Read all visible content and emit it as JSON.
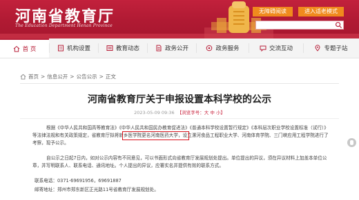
{
  "header": {
    "title": "河南省教育厅",
    "subtitle": "The Education Department Henan Province",
    "care_mode": "无障碍阅读",
    "elderly_mode": "进入适老模式",
    "search_placeholder": ""
  },
  "nav": {
    "items": [
      {
        "label": "首 页",
        "icon": "home-icon"
      },
      {
        "label": "机构设置",
        "icon": "building-icon"
      },
      {
        "label": "教育动态",
        "icon": "news-icon"
      },
      {
        "label": "政务公开",
        "icon": "document-icon"
      },
      {
        "label": "政务服务",
        "icon": "service-icon"
      },
      {
        "label": "交流互动",
        "icon": "chat-icon"
      },
      {
        "label": "专题子站",
        "icon": "pin-icon"
      }
    ],
    "active_index": 0
  },
  "breadcrumb": {
    "home": "首页",
    "info": "信息公开",
    "notice": "公告公示",
    "current": "正文"
  },
  "article": {
    "title": "河南省教育厅关于申报设置本科学校的公示",
    "date": "2023-05-09 09:36",
    "font_label": "【浏览字号：",
    "font_large": "大",
    "font_mid": "中",
    "font_small": "小",
    "font_end": "】",
    "p1": "根据《中华人民共和国高等教育法》《中华人民共和国民办教育促进法》《普通本科学校设置暂行规定》《本科层次职业学校设置标准（试行）》等法律法规和有关政策规定，省教育厅拟将新乡医学院更名河南医药大学，设立漯河食品工程职业大学、河南体育学院、三门峡应用工程学院进行了考察，现予公示。",
    "p2": "自公示之日起7日内，如对公示内容有不同意见，可以书面形式向省教育厅发展规划处提出。单位提出的异议，须在异议材料上加盖本单位公章，并写明联系人、联系电话、通讯地址。个人提出的异议，应署实名并提供有效的联系方式。",
    "phone": "联系电话：0371-69691956，69691887",
    "address": "邮寄地址：郑州市郑东新区正光路11号省教育厅发展规划处。"
  },
  "colors": {
    "brand_red": "#b8203a",
    "orange": "#f08a1d",
    "highlight_box": "#d8121b"
  }
}
